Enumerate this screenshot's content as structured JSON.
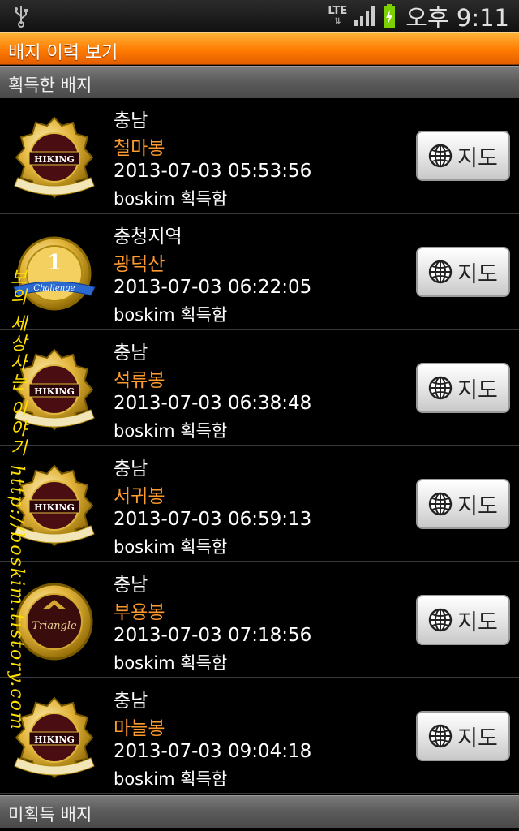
{
  "status_bar": {
    "network": "LTE",
    "time": "오후 9:11"
  },
  "title_bar": {
    "title": "배지 이력 보기"
  },
  "sections": {
    "acquired": "획득한 배지",
    "unacquired": "미획득 배지"
  },
  "badges": [
    {
      "region": "충남",
      "peak": "철마봉",
      "timestamp": "2013-07-03 05:53:56",
      "owner": "boskim 획득함",
      "badge_type": "hiking",
      "badge_text": "HIKING",
      "map_label": "지도"
    },
    {
      "region": "충청지역",
      "peak": "광덕산",
      "timestamp": "2013-07-03 06:22:05",
      "owner": "boskim 획득함",
      "badge_type": "challenge",
      "badge_text": "Challenge",
      "map_label": "지도"
    },
    {
      "region": "충남",
      "peak": "석류봉",
      "timestamp": "2013-07-03 06:38:48",
      "owner": "boskim 획득함",
      "badge_type": "hiking",
      "badge_text": "HIKING",
      "map_label": "지도"
    },
    {
      "region": "충남",
      "peak": "서귀봉",
      "timestamp": "2013-07-03 06:59:13",
      "owner": "boskim 획득함",
      "badge_type": "hiking",
      "badge_text": "HIKING",
      "map_label": "지도"
    },
    {
      "region": "충남",
      "peak": "부용봉",
      "timestamp": "2013-07-03 07:18:56",
      "owner": "boskim 획득함",
      "badge_type": "triangle",
      "badge_text": "Triangle",
      "map_label": "지도"
    },
    {
      "region": "충남",
      "peak": "마늘봉",
      "timestamp": "2013-07-03 09:04:18",
      "owner": "boskim 획득함",
      "badge_type": "hiking",
      "badge_text": "HIKING",
      "map_label": "지도"
    }
  ],
  "watermark": "보의 세상사는 이야기 http://boskim.tistory.com",
  "colors": {
    "accent": "#ff8c00",
    "peak_text": "#ff9a2e",
    "background": "#000000"
  }
}
